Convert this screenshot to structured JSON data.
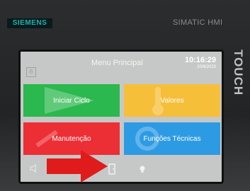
{
  "device": {
    "brand": "SIEMENS",
    "model": "SIMATIC HMI",
    "side_label": "TOUCH"
  },
  "screen": {
    "title": "Menu Principal",
    "time": "10:16:29",
    "date": "20/9/2023",
    "home_icon_glyph": "B",
    "tiles": [
      {
        "label": "Iniciar Ciclo",
        "color": "#2bb84e",
        "icon": "play-arrow-icon"
      },
      {
        "label": "Valores",
        "color": "#f6bf3a",
        "icon": "thermometer-icon"
      },
      {
        "label": "Manutenção",
        "color": "#ec2f35",
        "icon": "wrench-icon"
      },
      {
        "label": "Funções Técnicas",
        "color": "#2d9be3",
        "icon": "gear-icon"
      }
    ],
    "bottom_icons": [
      "speaker-icon",
      "screen-icon",
      "door-icon",
      "lightbulb-icon"
    ]
  },
  "annotation": {
    "color": "#e01b1b",
    "icon": "red-arrow-icon"
  }
}
